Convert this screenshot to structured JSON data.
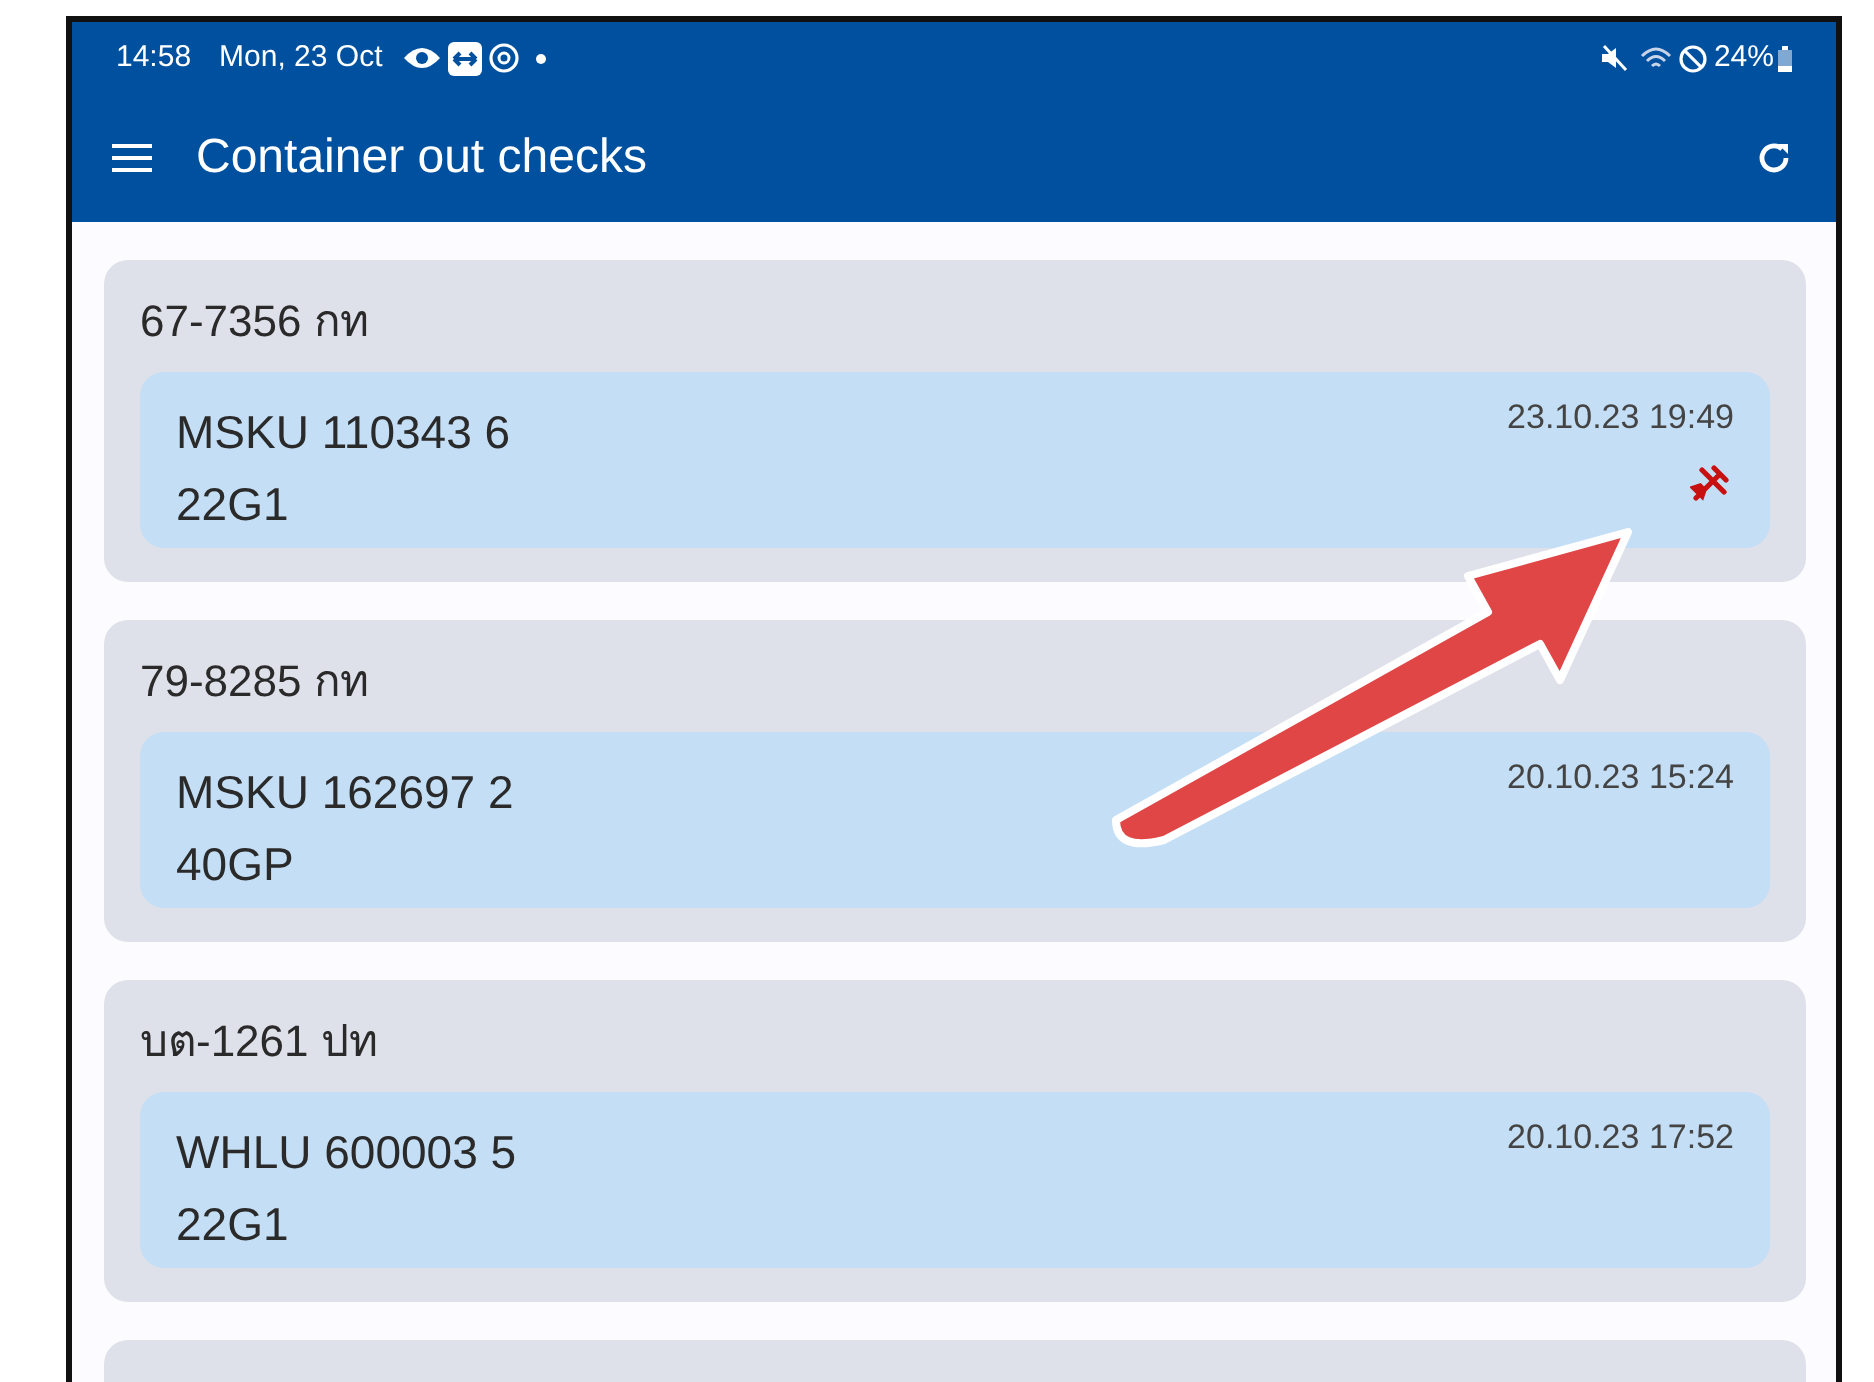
{
  "status_bar": {
    "time": "14:58",
    "date": "Mon, 23 Oct",
    "battery": "24%"
  },
  "app_bar": {
    "title": "Container out checks"
  },
  "checks": [
    {
      "plate": "67-7356 กท",
      "container": "MSKU 110343 6",
      "type": "22G1",
      "datetime": "23.10.23 19:49",
      "damaged": true
    },
    {
      "plate": "79-8285 กท",
      "container": "MSKU 162697 2",
      "type": "40GP",
      "datetime": "20.10.23 15:24",
      "damaged": false
    },
    {
      "plate": "บต-1261 ปท",
      "container": "WHLU 600003 5",
      "type": "22G1",
      "datetime": "20.10.23 17:52",
      "damaged": false
    }
  ]
}
